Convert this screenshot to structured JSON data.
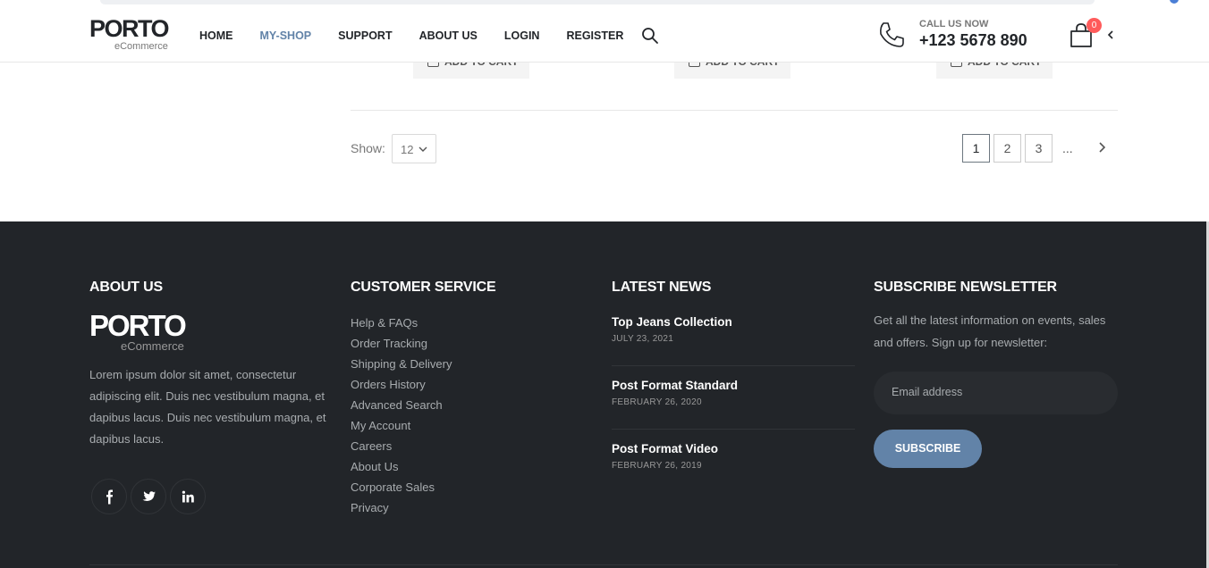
{
  "header": {
    "logo_text": "PORTO",
    "logo_sub": "eCommerce",
    "nav": [
      "HOME",
      "MY-SHOP",
      "SUPPORT",
      "ABOUT US",
      "LOGIN",
      "REGISTER"
    ],
    "active_nav": "MY-SHOP",
    "call_label": "CALL US NOW",
    "phone": "+123 5678 890",
    "cart_count": "0",
    "accent": "#6283a8"
  },
  "products": {
    "add_to_cart": [
      "ADD TO CART",
      "ADD TO CART",
      "ADD TO CART"
    ]
  },
  "pager": {
    "show_label": "Show:",
    "show_value": "12",
    "pages": [
      "1",
      "2",
      "3"
    ],
    "current": "1",
    "ellipsis": "..."
  },
  "footer": {
    "about": {
      "title": "ABOUT US",
      "logo_text": "PORTO",
      "logo_sub": "eCommerce",
      "text": "Lorem ipsum dolor sit amet, consectetur adipiscing elit. Duis nec vestibulum magna, et dapibus lacus. Duis nec vestibulum magna, et dapibus lacus.",
      "social": [
        "facebook-icon",
        "twitter-icon",
        "linkedin-icon"
      ]
    },
    "service": {
      "title": "CUSTOMER SERVICE",
      "links": [
        "Help & FAQs",
        "Order Tracking",
        "Shipping & Delivery",
        "Orders History",
        "Advanced Search",
        "My Account",
        "Careers",
        "About Us",
        "Corporate Sales",
        "Privacy"
      ]
    },
    "news": {
      "title": "LATEST NEWS",
      "items": [
        {
          "title": "Top Jeans Collection",
          "date": "JULY 23, 2021"
        },
        {
          "title": "Post Format Standard",
          "date": "FEBRUARY 26, 2020"
        },
        {
          "title": "Post Format Video",
          "date": "FEBRUARY 26, 2019"
        }
      ]
    },
    "newsletter": {
      "title": "SUBSCRIBE NEWSLETTER",
      "text": "Get all the latest information on events, sales and offers. Sign up for newsletter:",
      "email_placeholder": "Email address",
      "button": "SUBSCRIBE"
    },
    "bg_color": "#222529"
  }
}
